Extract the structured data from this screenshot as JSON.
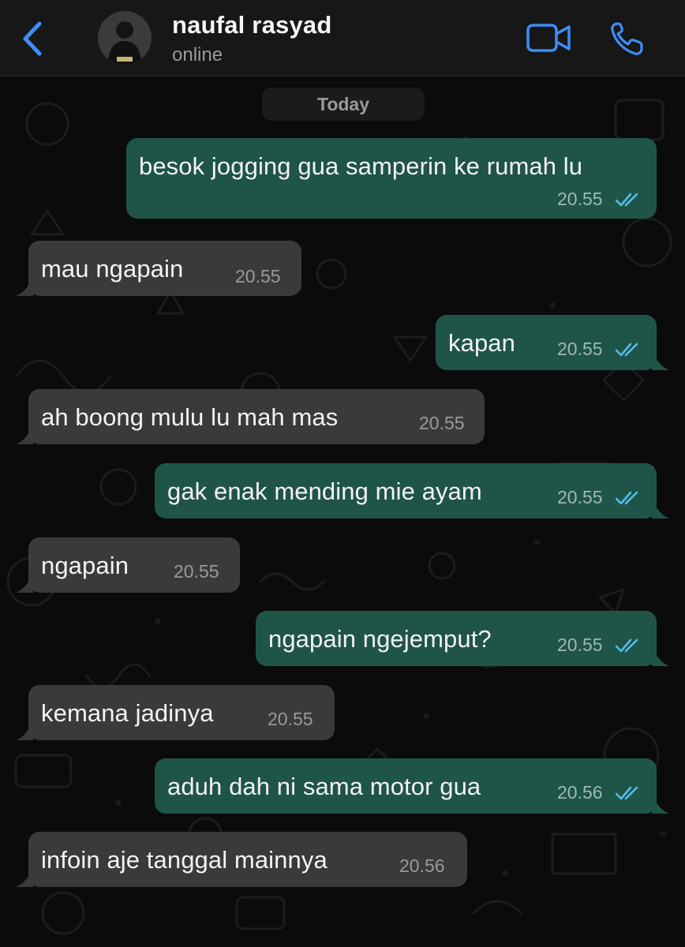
{
  "header": {
    "contact_name": "naufal rasyad",
    "status": "online"
  },
  "chat": {
    "date_label": "Today",
    "messages": [
      {
        "direction": "out",
        "text": "besok jogging gua samperin ke rumah lu",
        "time": "20.55",
        "status": "read"
      },
      {
        "direction": "in",
        "text": "mau ngapain",
        "time": "20.55"
      },
      {
        "direction": "out",
        "text": "kapan",
        "time": "20.55",
        "status": "read"
      },
      {
        "direction": "in",
        "text": "ah boong mulu lu mah mas",
        "time": "20.55"
      },
      {
        "direction": "out",
        "text": "gak enak mending mie ayam",
        "time": "20.55",
        "status": "read"
      },
      {
        "direction": "in",
        "text": "ngapain",
        "time": "20.55"
      },
      {
        "direction": "out",
        "text": "ngapain ngejemput?",
        "time": "20.55",
        "status": "read"
      },
      {
        "direction": "in",
        "text": "kemana jadinya",
        "time": "20.55"
      },
      {
        "direction": "out",
        "text": "aduh dah ni sama motor gua",
        "time": "20.56",
        "status": "read"
      },
      {
        "direction": "in",
        "text": "infoin aje tanggal mainnya",
        "time": "20.56"
      }
    ]
  },
  "colors": {
    "accent": "#3d8ef7",
    "outgoing_bubble": "#1f5449",
    "incoming_bubble": "#3a3a3c",
    "read_tick": "#53bdeb"
  },
  "icons": {
    "back": "chevron-left-icon",
    "video": "video-camera-icon",
    "call": "phone-icon",
    "read_receipt": "double-check-icon"
  }
}
